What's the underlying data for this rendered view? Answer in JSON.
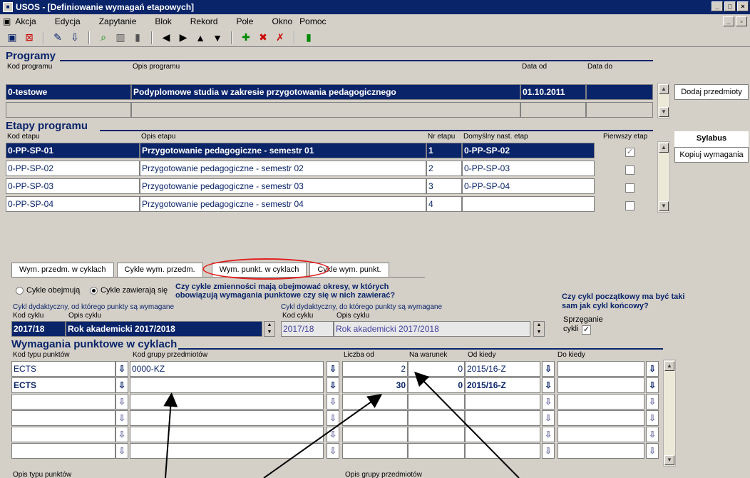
{
  "window": {
    "title": "USOS - [Definiowanie wymagań etapowych]"
  },
  "menu": [
    {
      "label": "Akcja"
    },
    {
      "label": "Edycja"
    },
    {
      "label": "Zapytanie"
    },
    {
      "label": "Blok"
    },
    {
      "label": "Rekord"
    },
    {
      "label": "Pole"
    },
    {
      "label": "Okno"
    },
    {
      "label": "Pomoc"
    }
  ],
  "programy": {
    "title": "Programy",
    "headers": {
      "kod": "Kod programu",
      "opis": "Opis programu",
      "data_od": "Data od",
      "data_do": "Data do"
    },
    "rows": [
      {
        "kod": "0-testowe",
        "opis": "Podyplomowe studia w zakresie przygotowania pedagogicznego",
        "data_od": "01.10.2011",
        "data_do": ""
      }
    ],
    "side_button": "Dodaj przedmioty"
  },
  "etapy": {
    "title": "Etapy programu",
    "headers": {
      "kod": "Kod etapu",
      "opis": "Opis etapu",
      "nr": "Nr etapu",
      "domyslny": "Domyślny nast. etap",
      "pierwszy": "Pierwszy etap"
    },
    "rows": [
      {
        "kod": "0-PP-SP-01",
        "opis": "Przygotowanie pedagogiczne - semestr 01",
        "nr": "1",
        "nast": "0-PP-SP-02"
      },
      {
        "kod": "0-PP-SP-02",
        "opis": "Przygotowanie pedagogiczne - semestr 02",
        "nr": "2",
        "nast": "0-PP-SP-03"
      },
      {
        "kod": "0-PP-SP-03",
        "opis": "Przygotowanie pedagogiczne - semestr 03",
        "nr": "3",
        "nast": "0-PP-SP-04"
      },
      {
        "kod": "0-PP-SP-04",
        "opis": "Przygotowanie pedagogiczne - semestr 04",
        "nr": "4",
        "nast": ""
      }
    ],
    "sylabus": "Sylabus",
    "kopiuj": "Kopiuj wymagania"
  },
  "tabs": [
    {
      "label": "Wym. przedm. w cyklach"
    },
    {
      "label": "Cykle wym. przedm."
    },
    {
      "label": "Wym. punkt. w cyklach"
    },
    {
      "label": "Cykle wym. punkt."
    }
  ],
  "cycles": {
    "radio1": "Cykle obejmują",
    "radio2": "Cykle zawierają się",
    "question": "Czy cykle zmienności mają obejmować okresy, w których obowiązują wymagania punktowe czy się w nich zawierać?",
    "start_label": "Cykl dydaktyczny, od którego punkty są wymagane",
    "end_label": "Cykl dydaktyczny, do którego punkty są wymagane",
    "kod_cyklu": "Kod cyklu",
    "opis_cyklu": "Opis cyklu",
    "start_kod": "2017/18",
    "start_opis": "Rok akademicki 2017/2018",
    "end_kod": "2017/18",
    "end_opis": "Rok akademicki 2017/2018",
    "same_question": "Czy cykl początkowy ma być taki sam jak cykl końcowy?",
    "sprzeganie": "Sprzęganie",
    "cykli": "cykli"
  },
  "wymagania": {
    "title": "Wymagania punktowe w cyklach",
    "headers": {
      "kod_typu": "Kod typu punktów",
      "kod_grupy": "Kod grupy przedmiotów",
      "liczba_od": "Liczba od",
      "na_warunek": "Na warunek",
      "od_kiedy": "Od kiedy",
      "do_kiedy": "Do kiedy"
    },
    "rows": [
      {
        "typ": "ECTS",
        "grupa": "0000-KZ",
        "liczba": "2",
        "warunek": "0",
        "od": "2015/16-Z",
        "do": ""
      },
      {
        "typ": "ECTS",
        "grupa": "",
        "liczba": "30",
        "warunek": "0",
        "od": "2015/16-Z",
        "do": ""
      }
    ],
    "bottom_left": "Opis typu punktów",
    "bottom_right": "Opis grupy przedmiotów"
  }
}
